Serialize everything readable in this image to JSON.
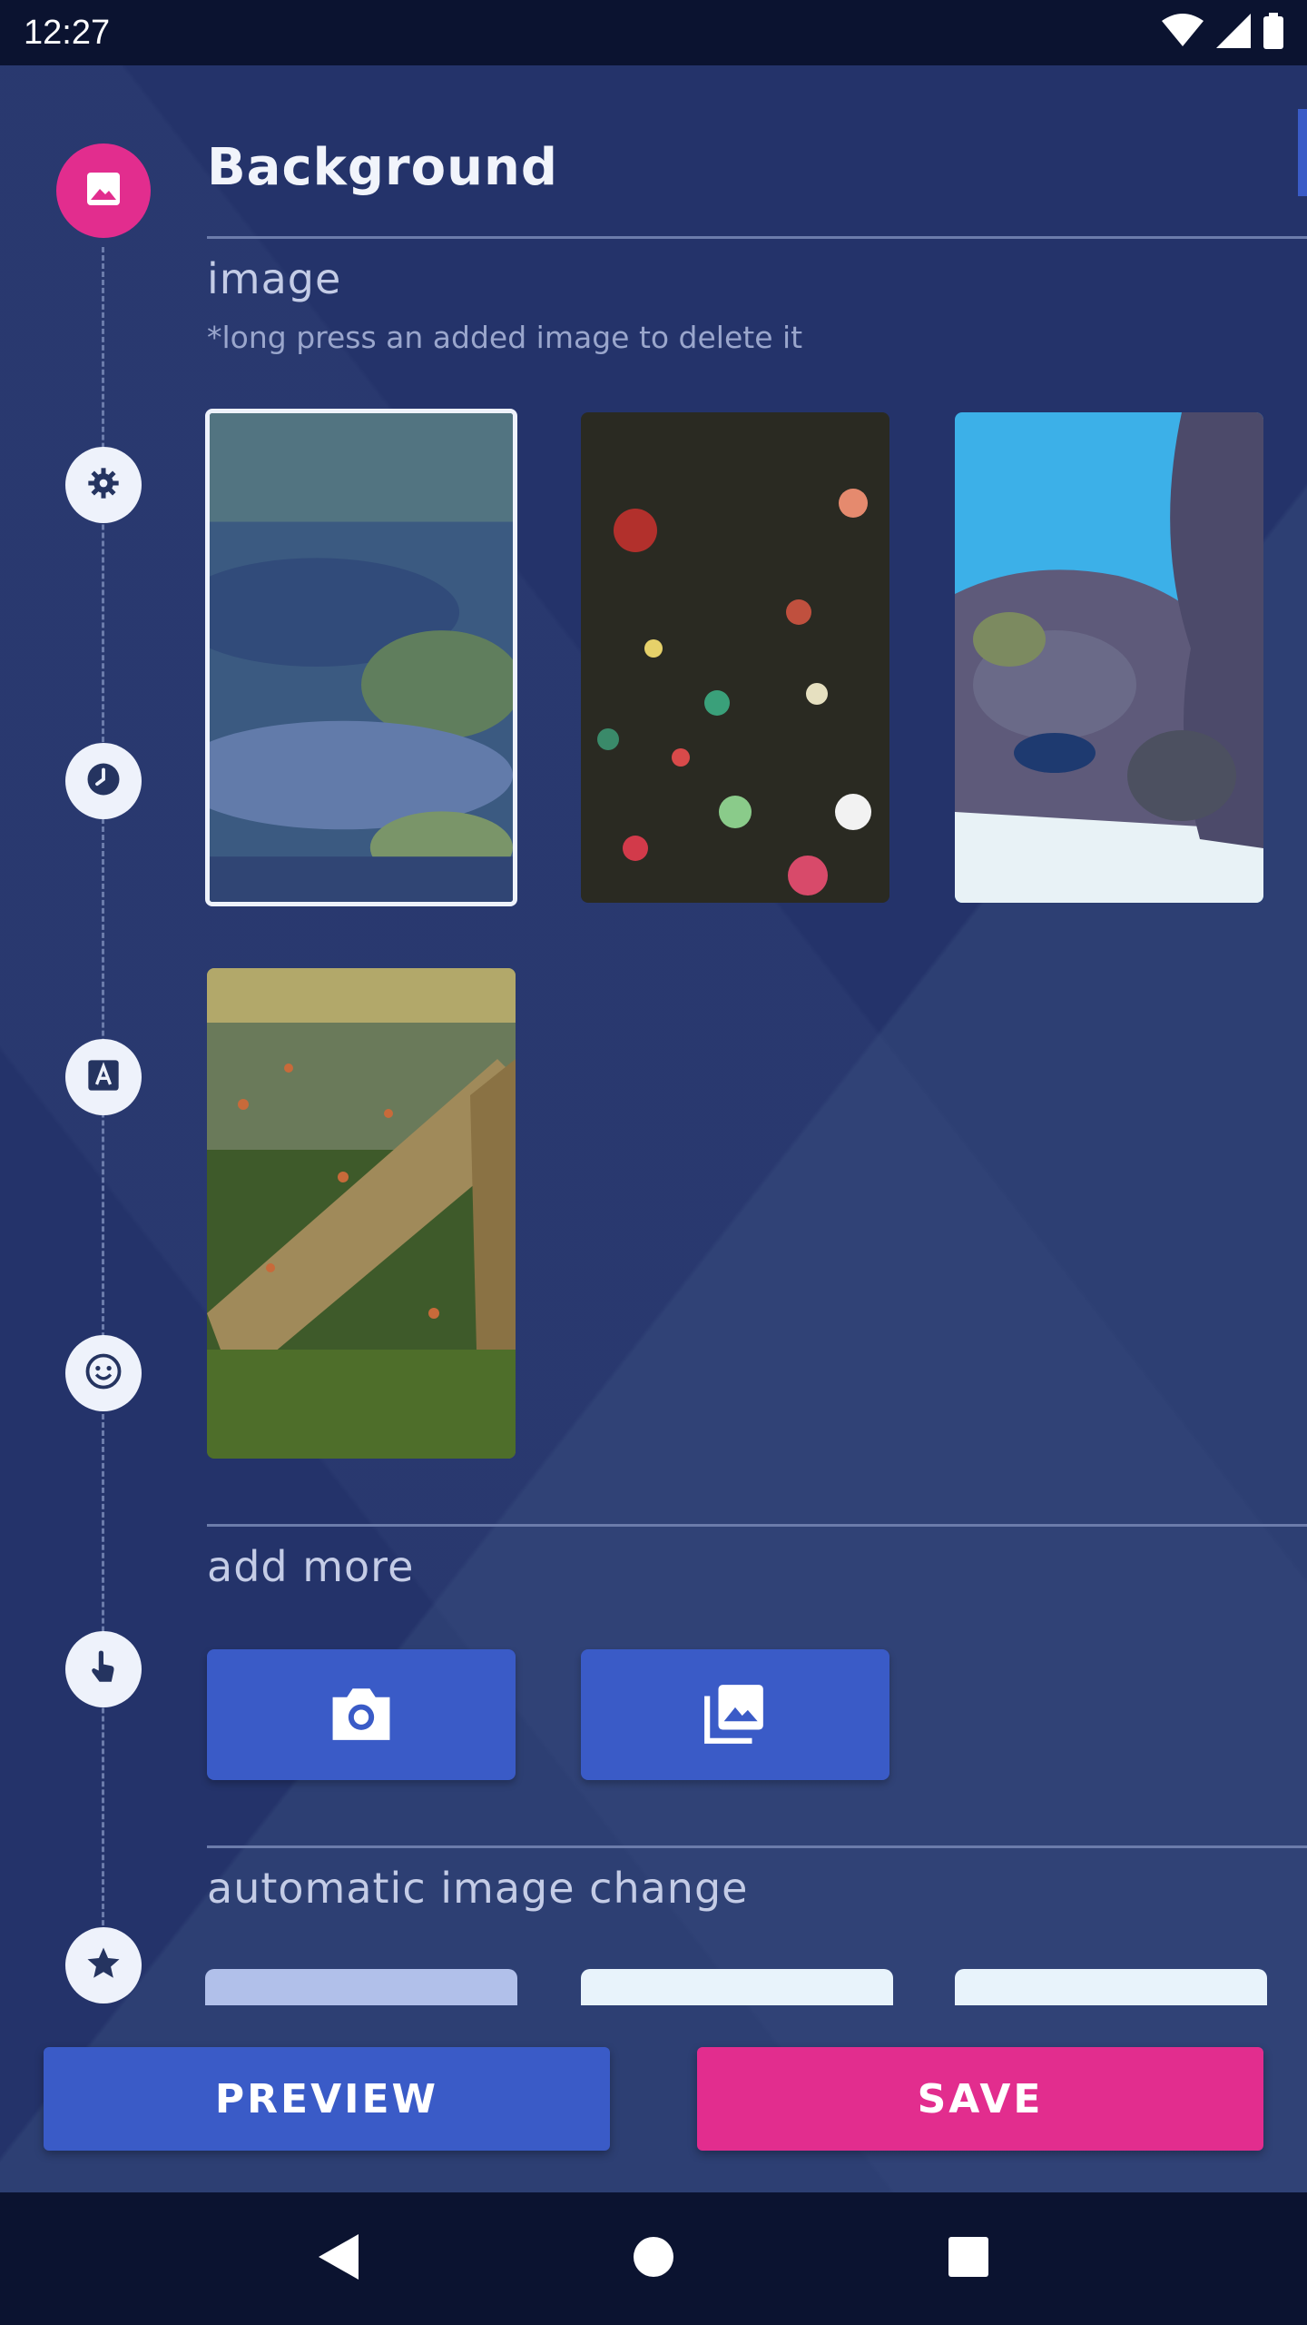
{
  "status_bar": {
    "time": "12:27",
    "icons": [
      "wifi-icon",
      "signal-icon",
      "battery-icon"
    ]
  },
  "section": {
    "title": "Background",
    "icon": "image-icon"
  },
  "timeline": {
    "items": [
      "image-icon",
      "settings-icon",
      "clock-icon",
      "font-icon",
      "emoji-icon",
      "touch-icon",
      "star-icon"
    ]
  },
  "image_section": {
    "heading": "image",
    "hint": "*long press an added image to delete it",
    "thumbnails": [
      {
        "name": "aquarium-plants-thumbnail",
        "selected": true
      },
      {
        "name": "coral-reef-dark-thumbnail",
        "selected": false
      },
      {
        "name": "reef-rock-blue-thumbnail",
        "selected": false
      },
      {
        "name": "driftwood-fish-thumbnail",
        "selected": false
      }
    ]
  },
  "add_more": {
    "heading": "add more",
    "buttons": [
      "camera-icon",
      "gallery-icon"
    ]
  },
  "auto_change": {
    "heading": "automatic image change"
  },
  "actions": {
    "preview": "PREVIEW",
    "save": "SAVE"
  },
  "colors": {
    "accent": "#e22d8e",
    "primary": "#3a5bc7",
    "background": "#24336a"
  }
}
